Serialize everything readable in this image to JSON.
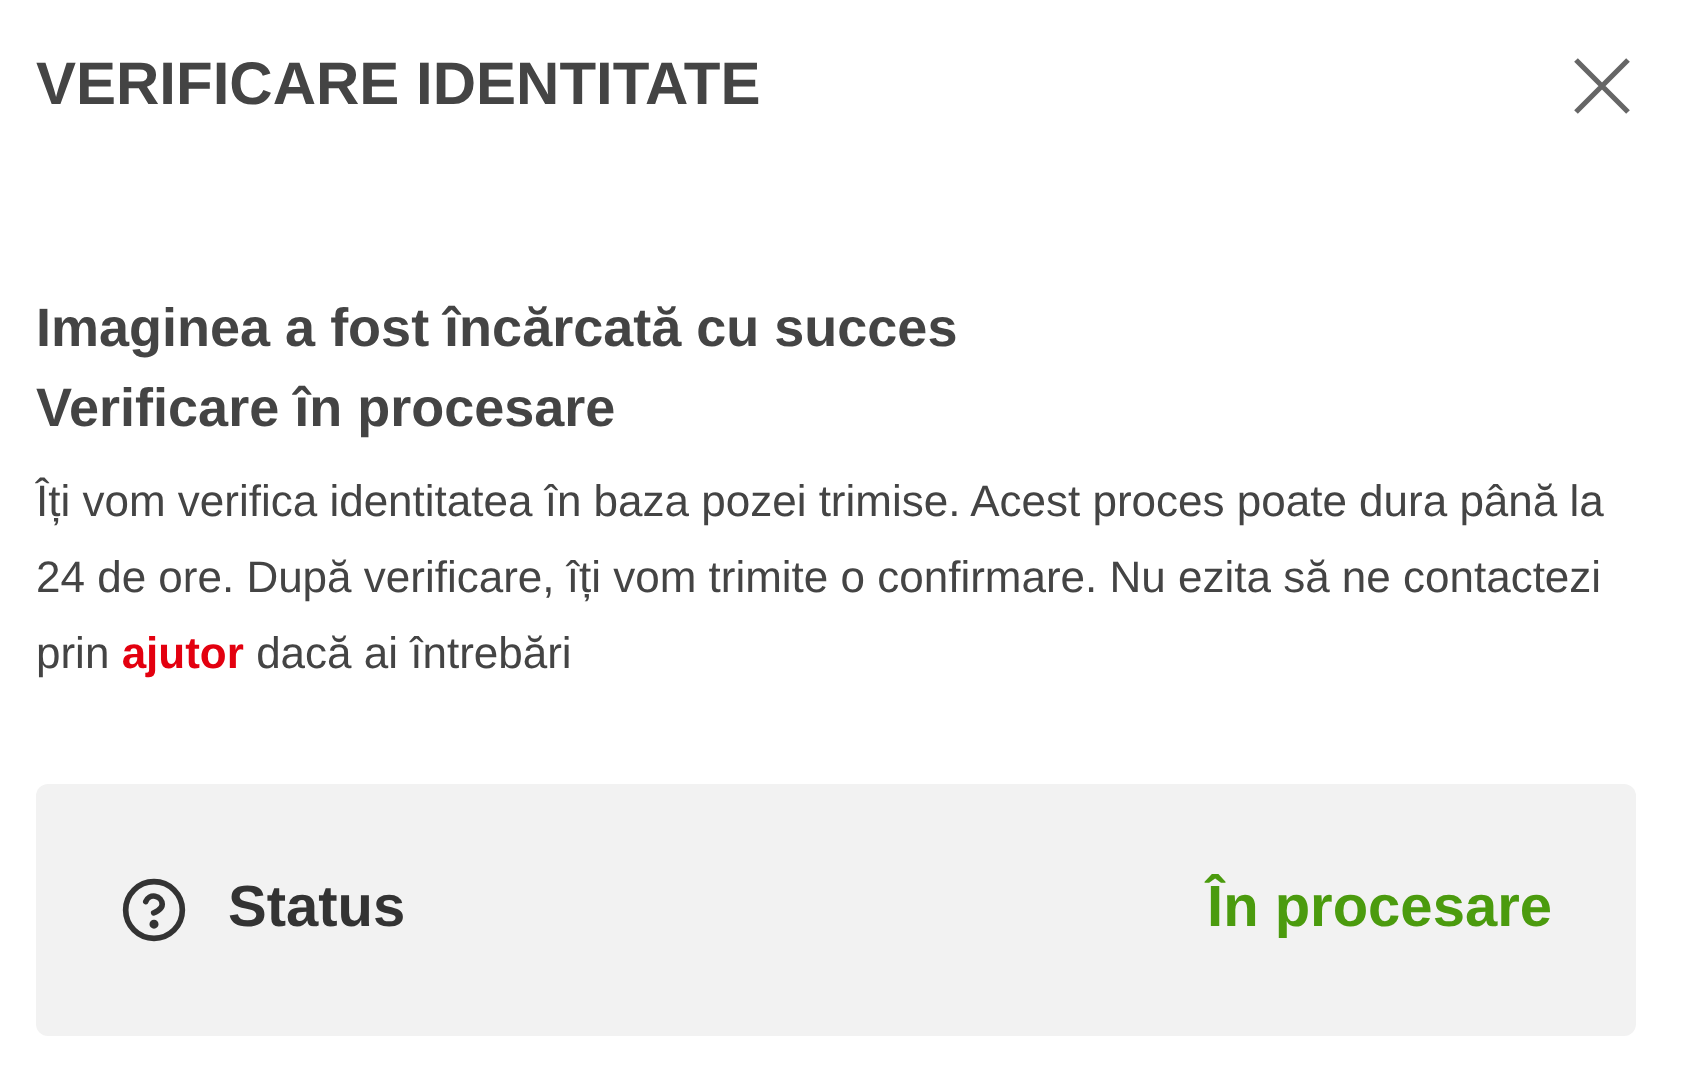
{
  "dialog": {
    "title": "VERIFICARE IDENTITATE"
  },
  "heading": [
    "Imaginea a fost încărcată cu succes",
    "Verificare în procesare"
  ],
  "message": {
    "before": "Îți vom verifica identitatea în baza pozei trimise. Acest proces poate dura până la 24 de ore. După verificare, îți vom trimite o confirmare. Nu ezita să ne contactezi prin",
    "link": "ajutor",
    "after": "dacă ai întrebări"
  },
  "status": {
    "label": "Status",
    "value": "În procesare"
  }
}
